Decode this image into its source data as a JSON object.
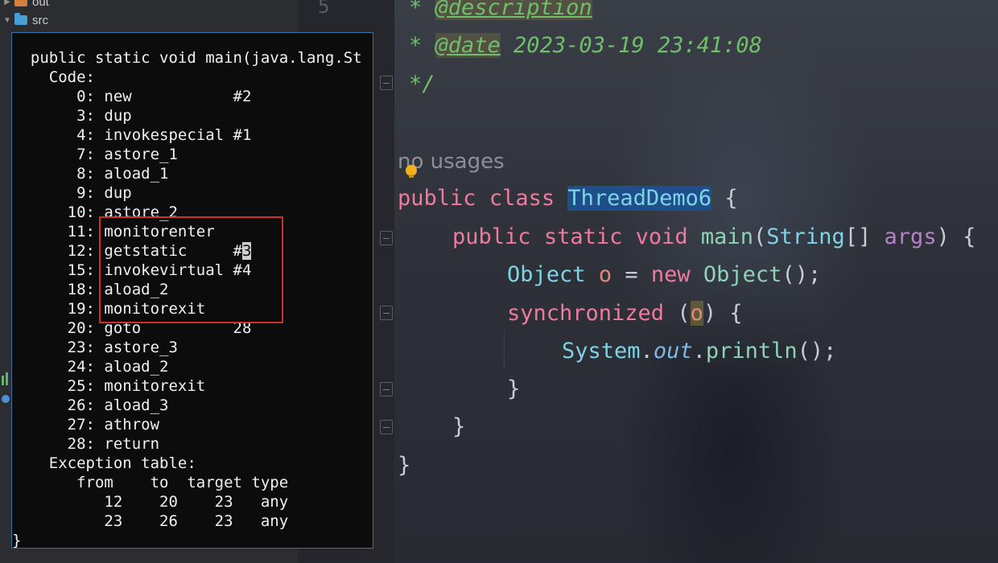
{
  "project_tree": {
    "items": [
      {
        "label": "out",
        "color": "#d4813d"
      },
      {
        "label": "src",
        "color": "#4a9ed6"
      }
    ]
  },
  "editor": {
    "line_number": "5",
    "doc": {
      "description_line": {
        "star": "* ",
        "tag": "@description"
      },
      "date_line": {
        "star": "* ",
        "tag": "@date",
        "value": " 2023-03-19 23:41:08"
      },
      "close": "*/"
    },
    "usages_hint": "no usages",
    "class_line": {
      "kw1": "public",
      "kw2": "class",
      "name": "ThreadDemo6",
      "brace": " {"
    },
    "main_line": {
      "kw1": "public",
      "kw2": "static",
      "kw3": "void",
      "name": "main",
      "paren_open": "(",
      "type": "String",
      "brackets": "[] ",
      "param": "args",
      "paren_close": ") {"
    },
    "object_line": {
      "type": "Object",
      "var": "o",
      "eq": " = ",
      "kw": "new",
      "ctor": "Object",
      "end": "();"
    },
    "sync_line": {
      "kw": "synchronized",
      "open": " (",
      "var": "o",
      "close": ") {"
    },
    "print_line": {
      "cls": "System",
      "dot1": ".",
      "field": "out",
      "dot2": ".",
      "method": "println",
      "end": "();"
    },
    "close_inner": "}",
    "close_method": "}",
    "close_class": "}"
  },
  "terminal": {
    "lines": [
      "  public static void main(java.lang.St",
      "    Code:",
      "       0: new           #2",
      "       3: dup",
      "       4: invokespecial #1",
      "       7: astore_1",
      "       8: aload_1",
      "       9: dup",
      "      10: astore_2",
      "      11: monitorenter",
      "      12: getstatic     #",
      "      15: invokevirtual #4",
      "      18: aload_2",
      "      19: monitorexit",
      "      20: goto          28",
      "      23: astore_3",
      "      24: aload_2",
      "      25: monitorexit",
      "      26: aload_3",
      "      27: athrow",
      "      28: return",
      "    Exception table:",
      "       from    to  target type",
      "          12    20    23   any",
      "          23    26    23   any",
      "}"
    ],
    "cursor_char": "3"
  }
}
